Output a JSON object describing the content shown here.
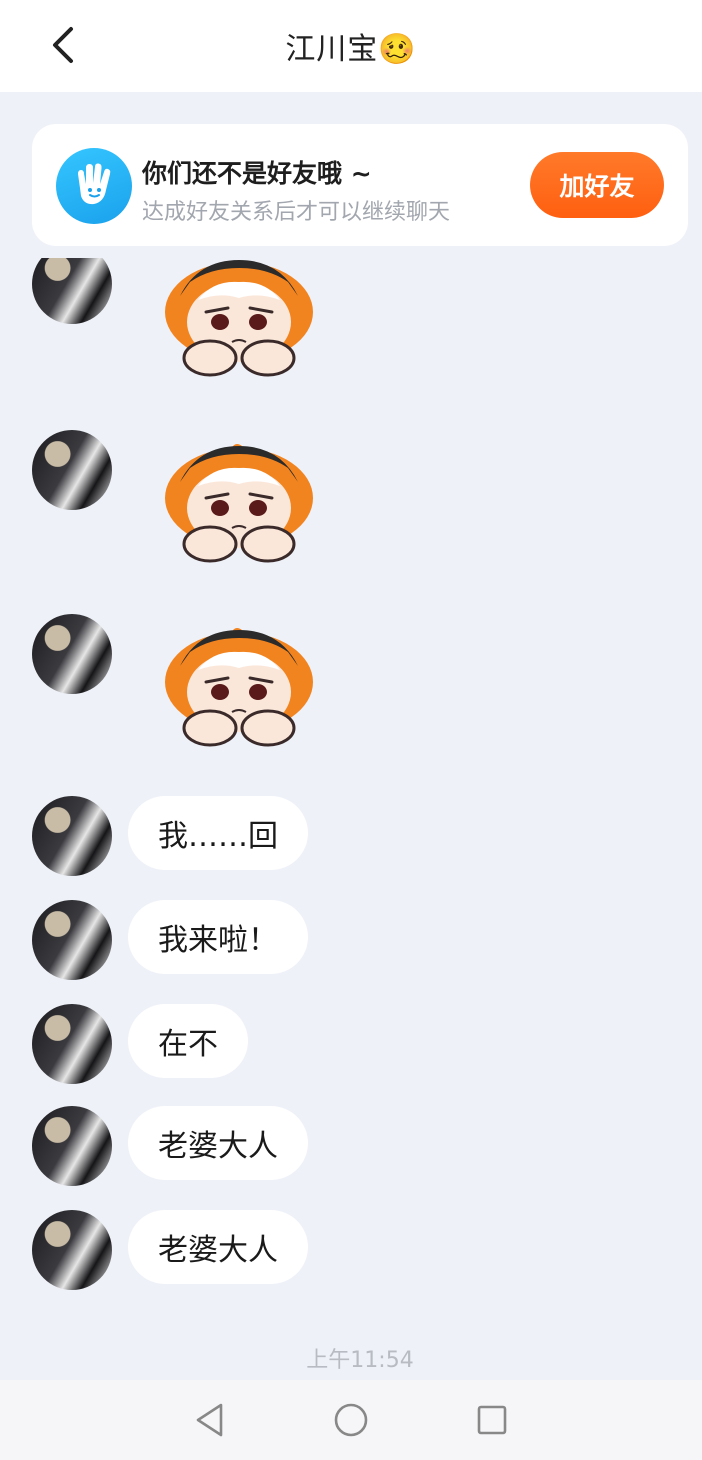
{
  "header": {
    "title": "江川宝🥴",
    "back_icon": "chevron-left-icon"
  },
  "friend_banner": {
    "icon": "waving-hand-icon",
    "title": "你们还不是好友哦 ~",
    "subtitle": "达成好友关系后才可以继续聊天",
    "add_button_label": "加好友",
    "accent_color": "#ff6a1a"
  },
  "messages": [
    {
      "type": "sticker",
      "sticker": "sad-anime-girl-sticker"
    },
    {
      "type": "sticker",
      "sticker": "sad-anime-girl-sticker"
    },
    {
      "type": "sticker",
      "sticker": "sad-anime-girl-sticker"
    },
    {
      "type": "text",
      "text": "我……回"
    },
    {
      "type": "text",
      "text": "我来啦！"
    },
    {
      "type": "text",
      "text": "在不"
    },
    {
      "type": "text",
      "text": "老婆大人"
    },
    {
      "type": "text",
      "text": "老婆大人"
    }
  ],
  "timestamp": "上午11:54",
  "navbar": {
    "back": "triangle-back-icon",
    "home": "circle-home-icon",
    "recents": "square-recents-icon"
  }
}
